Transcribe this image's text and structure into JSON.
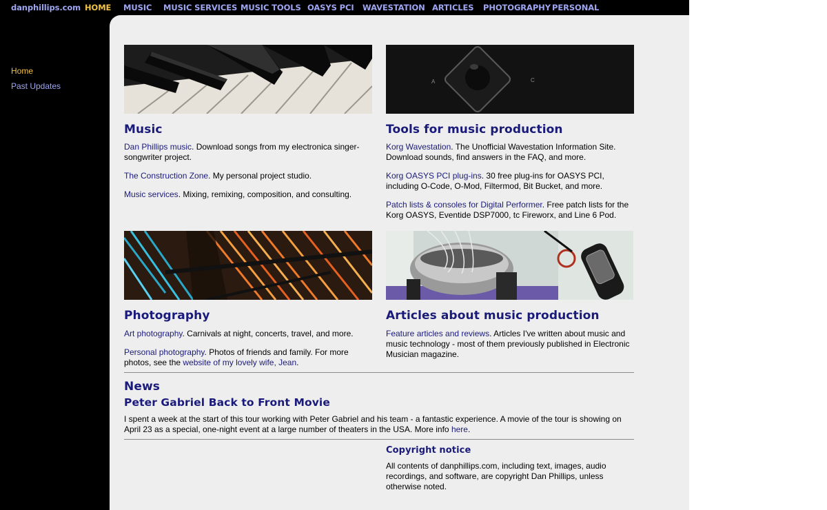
{
  "site_name": "danphillips.com",
  "nav": [
    {
      "label": "HOME",
      "active": true
    },
    {
      "label": "MUSIC"
    },
    {
      "label": "MUSIC SERVICES"
    },
    {
      "label": "MUSIC TOOLS"
    },
    {
      "label": "OASYS PCI"
    },
    {
      "label": "WAVESTATION"
    },
    {
      "label": "ARTICLES"
    },
    {
      "label": "PHOTOGRAPHY"
    },
    {
      "label": "PERSONAL"
    }
  ],
  "sidebar": {
    "items": [
      {
        "label": "Home",
        "active": true
      },
      {
        "label": "Past Updates"
      }
    ]
  },
  "music": {
    "title": "Music",
    "p1_link": "Dan Phillips music",
    "p1_text": ". Download songs from my electronica singer-songwriter project.",
    "p2_link": "The Construction Zone",
    "p2_text": ". My personal project studio.",
    "p3_link": "Music services",
    "p3_text": ". Mixing, remixing, composition, and consulting."
  },
  "tools": {
    "title": "Tools for music production",
    "p1_link": "Korg Wavestation",
    "p1_text": ". The Unofficial Wavestation Information Site. Download sounds, find answers in the FAQ, and more.",
    "p2_link": "Korg OASYS PCI plug-ins",
    "p2_text": ". 30 free plug-ins for OASYS PCI, including O-Code, O-Mod, Filtermod, Bit Bucket, and more.",
    "p3_link": "Patch lists & consoles for Digital Performer",
    "p3_text": ". Free patch lists for the Korg OASYS, Eventide DSP7000, tc Fireworx, and Line 6 Pod.",
    "image_label_a": "A",
    "image_label_c": "C"
  },
  "photography": {
    "title": "Photography",
    "p1_link": "Art photography",
    "p1_text": ". Carnivals at night, concerts, travel, and more.",
    "p2_link": "Personal photography",
    "p2_text": ". Photos of friends and family. For more photos, see the ",
    "p2_link2": "website of my lovely wife, Jean",
    "p2_end": "."
  },
  "articles": {
    "title": "Articles about music production",
    "p1_link": "Feature articles and reviews",
    "p1_text": ". Articles I've written about music and music technology - most of them previously published in Electronic Musician magazine."
  },
  "news": {
    "title": "News",
    "headline": "Peter Gabriel Back to Front Movie",
    "body": "I spent a week at the start of this tour working with Peter Gabriel and his team - a fantastic experience. A movie of the tour is showing on April 23 as a special, one-night event at a large number of theaters in the USA. More info ",
    "link": "here",
    "end": "."
  },
  "copyright": {
    "title": "Copyright notice",
    "body": "All contents of danphillips.com, including text, images, audio recordings, and software, are copyright Dan Phillips, unless otherwise noted."
  },
  "colors": {
    "nav_link": "#9ea6f2",
    "nav_active": "#f2c244",
    "heading": "#1a1a7a",
    "panel_bg": "#eeeeee"
  }
}
